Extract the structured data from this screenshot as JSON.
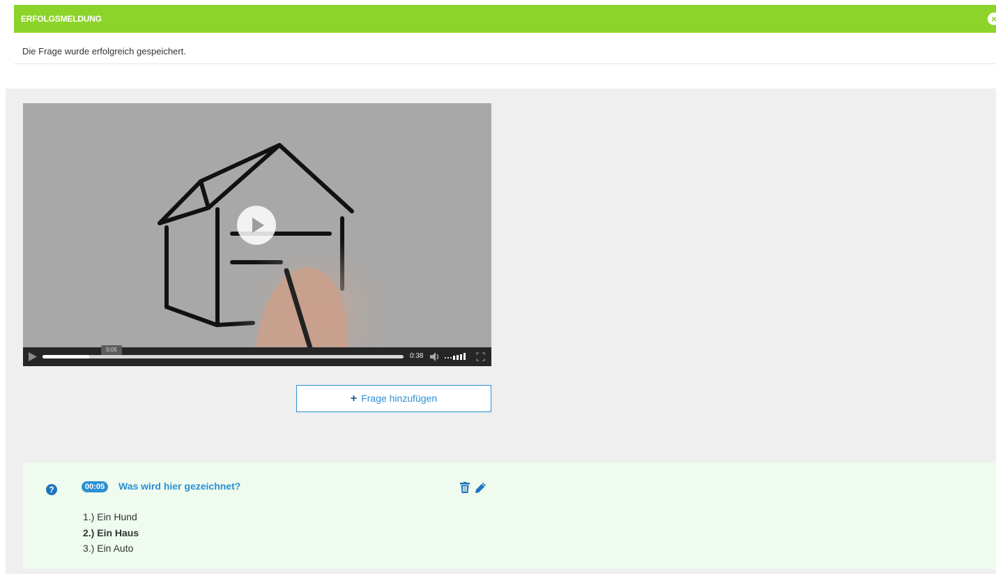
{
  "alert": {
    "title": "ERFOLGSMELDUNG",
    "message": "Die Frage wurde erfolgreich gespeichert.",
    "close_icon": "close-circle-icon",
    "color": "#8cd42a"
  },
  "video": {
    "current_time_label": "0:05",
    "duration_label": "0:38",
    "progress": 0.13,
    "play_icon": "play-icon",
    "volume_icon": "volume-icon",
    "fullscreen_icon": "fullscreen-icon"
  },
  "add_question": {
    "label": "Frage hinzufügen",
    "icon": "plus-icon"
  },
  "question": {
    "time_badge": "00:05",
    "title": "Was wird hier gezeichnet?",
    "answers": [
      {
        "label": "1.) Ein Hund",
        "correct": false
      },
      {
        "label": "2.) Ein Haus",
        "correct": true
      },
      {
        "label": "3.) Ein Auto",
        "correct": false
      }
    ],
    "icons": [
      "question-icon",
      "trash-icon",
      "pencil-icon"
    ],
    "accent_color": "#2b8fd4"
  }
}
